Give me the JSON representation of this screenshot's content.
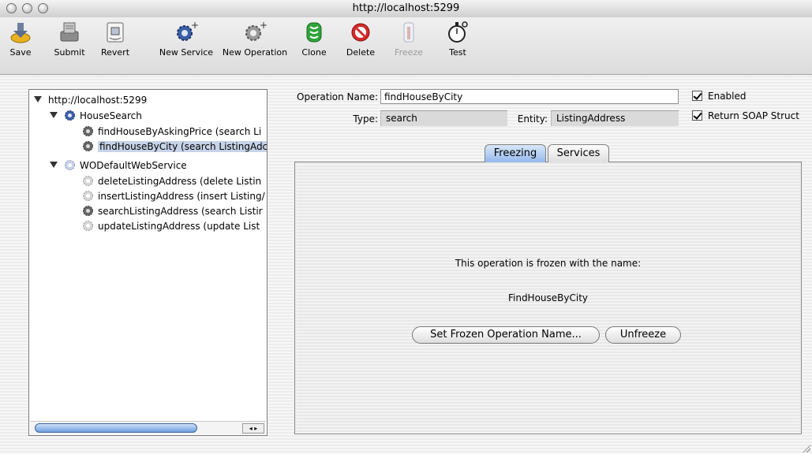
{
  "window": {
    "title": "http://localhost:5299"
  },
  "toolbar": {
    "items": [
      {
        "label": "Save",
        "icon": "save-icon",
        "enabled": true
      },
      {
        "label": "Submit",
        "icon": "submit-icon",
        "enabled": true
      },
      {
        "label": "Revert",
        "icon": "revert-icon",
        "enabled": true
      },
      {
        "label": "New Service",
        "icon": "new-service-icon",
        "enabled": true
      },
      {
        "label": "New Operation",
        "icon": "new-operation-icon",
        "enabled": true
      },
      {
        "label": "Clone",
        "icon": "clone-icon",
        "enabled": true
      },
      {
        "label": "Delete",
        "icon": "delete-icon",
        "enabled": true
      },
      {
        "label": "Freeze",
        "icon": "freeze-icon",
        "enabled": false
      },
      {
        "label": "Test",
        "icon": "test-stopwatch-icon",
        "enabled": true
      }
    ]
  },
  "tree": {
    "root": "http://localhost:5299",
    "services": [
      {
        "name": "HouseSearch",
        "operations": [
          {
            "label": "findHouseByAskingPrice (search Li",
            "selected": false
          },
          {
            "label": "findHouseByCity (search ListingAdc",
            "selected": true
          }
        ]
      },
      {
        "name": "WODefaultWebService",
        "operations": [
          {
            "label": "deleteListingAddress (delete Listin",
            "selected": false
          },
          {
            "label": "insertListingAddress (insert Listing/",
            "selected": false
          },
          {
            "label": "searchListingAddress (search Listir",
            "selected": false
          },
          {
            "label": "updateListingAddress (update List",
            "selected": false
          }
        ]
      }
    ]
  },
  "form": {
    "operation_name_label": "Operation Name:",
    "operation_name_value": "findHouseByCity",
    "type_label": "Type:",
    "type_value": "search",
    "entity_label": "Entity:",
    "entity_value": "ListingAddress",
    "enabled_label": "Enabled",
    "enabled_checked": true,
    "return_soap_label": "Return SOAP Struct",
    "return_soap_checked": true
  },
  "tabs": [
    {
      "label": "Freezing",
      "active": true
    },
    {
      "label": "Services",
      "active": false
    }
  ],
  "freezing": {
    "message": "This operation is frozen with the name:",
    "frozen_name": "FindHouseByCity",
    "set_button": "Set Frozen Operation Name...",
    "unfreeze_button": "Unfreeze"
  },
  "colors": {
    "selection": "#c6d3e8",
    "active_tab": "#94b9ec",
    "delete_red": "#d42a2a",
    "clone_green": "#2fa33a"
  }
}
